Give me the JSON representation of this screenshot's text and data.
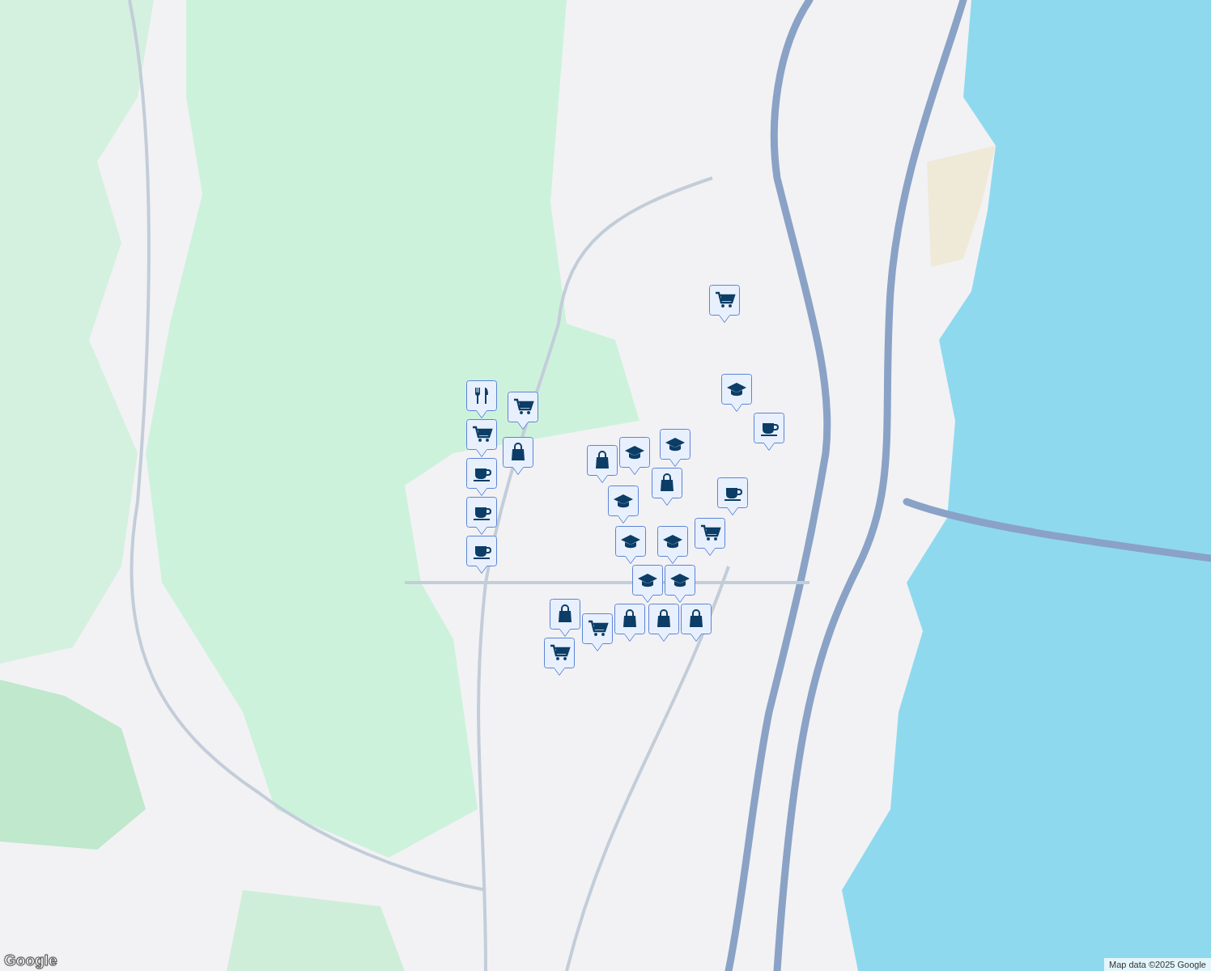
{
  "map": {
    "pins": [
      {
        "kind": "cart"
      },
      {
        "kind": "fork"
      },
      {
        "kind": "cart"
      },
      {
        "kind": "bag"
      },
      {
        "kind": "cup"
      },
      {
        "kind": "cup"
      },
      {
        "kind": "cup"
      },
      {
        "kind": "cart"
      },
      {
        "kind": "school"
      },
      {
        "kind": "cup"
      },
      {
        "kind": "bag"
      },
      {
        "kind": "school"
      },
      {
        "kind": "school"
      },
      {
        "kind": "bag"
      },
      {
        "kind": "cup"
      },
      {
        "kind": "cart"
      },
      {
        "kind": "school"
      },
      {
        "kind": "school"
      },
      {
        "kind": "school"
      },
      {
        "kind": "school"
      },
      {
        "kind": "school"
      },
      {
        "kind": "bag"
      },
      {
        "kind": "bag"
      },
      {
        "kind": "bag"
      },
      {
        "kind": "cart"
      },
      {
        "kind": "bag"
      },
      {
        "kind": "cart"
      }
    ],
    "logo": "Google",
    "attribution": "Map data ©2025 Google"
  }
}
